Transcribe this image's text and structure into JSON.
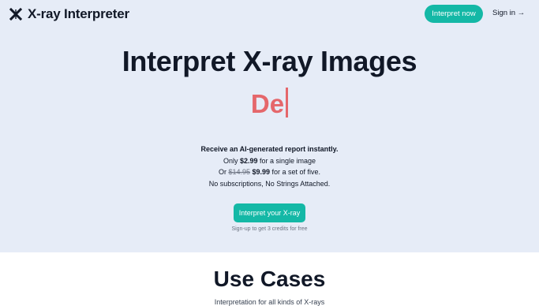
{
  "header": {
    "brand": "X-ray Interpreter",
    "brand_icon": "x-logo-icon",
    "cta_label": "Interpret now",
    "signin_label": "Sign in →"
  },
  "hero": {
    "title": "Interpret X-ray Images",
    "typed_text": "De",
    "pitch_line1": "Receive an AI-generated report instantly.",
    "line2_prefix": "Only ",
    "line2_price": "$2.99",
    "line2_suffix": " for a single image",
    "line3_prefix": "Or ",
    "line3_old_price": "$14.95",
    "line3_price": "$9.99",
    "line3_suffix": " for a set of five.",
    "line4": "No subscriptions, No Strings Attached.",
    "cta_label": "Interpret your X-ray",
    "credits_note": "Sign-up to get 3 credits for free"
  },
  "use_cases": {
    "title": "Use Cases",
    "subtitle": "Interpretation for all kinds of X-rays"
  },
  "colors": {
    "hero_bg": "#e6ecf7",
    "accent_teal": "#14b8a6",
    "typed_red": "#e5676b",
    "text_dark": "#111827"
  }
}
